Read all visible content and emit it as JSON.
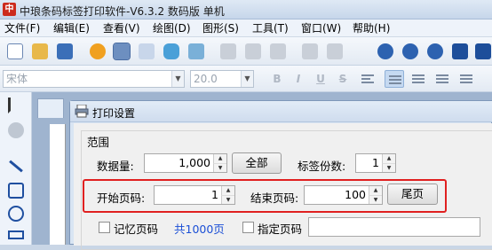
{
  "window": {
    "title": "中琅条码标签打印软件-V6.3.2 数码版 单机",
    "logo_text": "中"
  },
  "menu": {
    "items": [
      "文件(F)",
      "编辑(E)",
      "查看(V)",
      "绘图(D)",
      "图形(S)",
      "工具(T)",
      "窗口(W)",
      "帮助(H)"
    ]
  },
  "format_bar": {
    "font_name": "宋体",
    "font_size": "20.0",
    "bold": "B",
    "italic": "I",
    "underline": "U",
    "strike": "S"
  },
  "dialog": {
    "title": "打印设置",
    "range_group": "范围",
    "data_count_label": "数据量:",
    "data_count_value": "1,000",
    "all_button": "全部",
    "copies_label": "标签份数:",
    "copies_value": "1",
    "start_page_label": "开始页码:",
    "start_page_value": "1",
    "end_page_label": "结束页码:",
    "end_page_value": "100",
    "last_page_button": "尾页",
    "remember_page_label": "记忆页码",
    "total_pages": "共1000页",
    "specified_page_label": "指定页码"
  },
  "colors": {
    "highlight": "#e02020",
    "link": "#1b4fd6"
  }
}
